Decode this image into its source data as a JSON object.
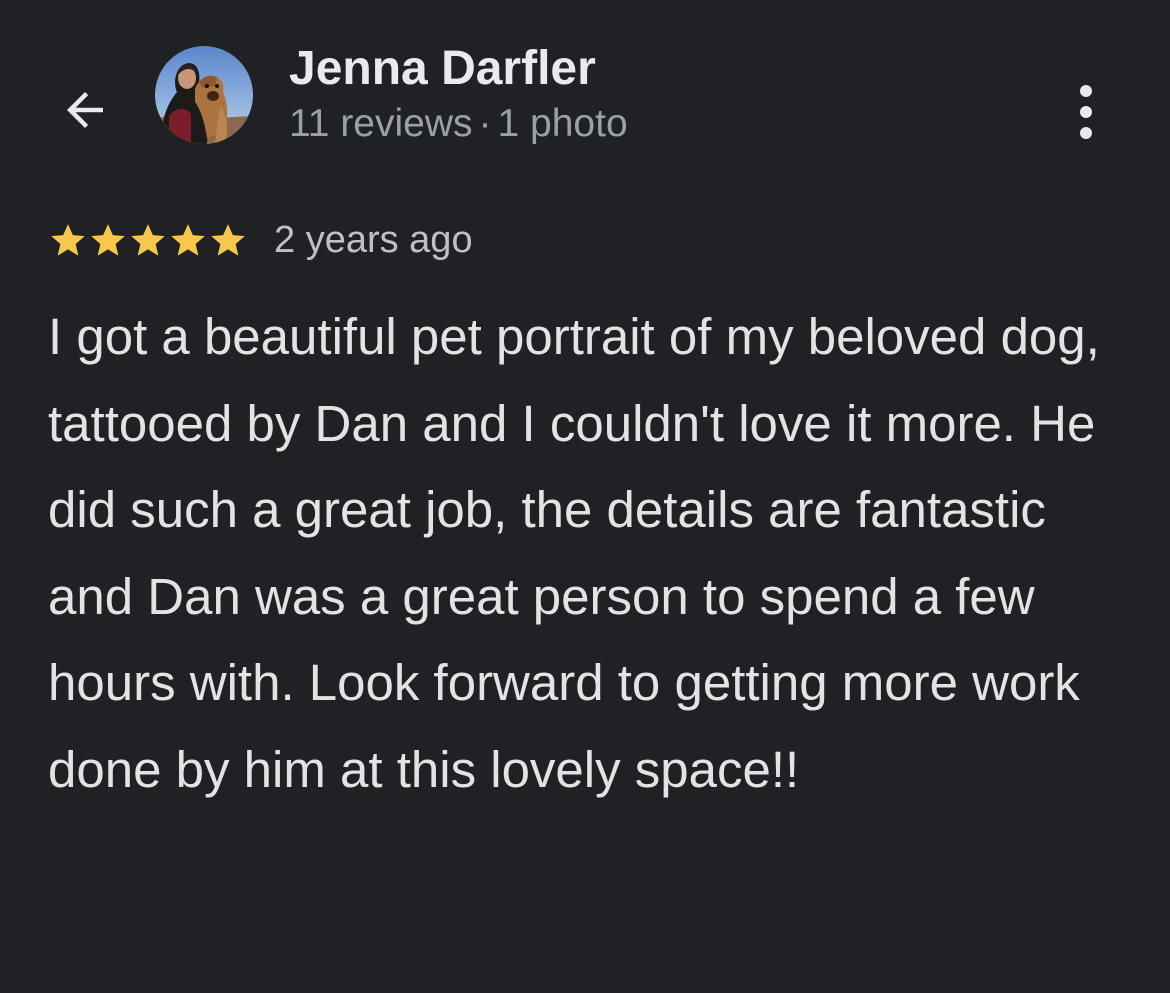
{
  "header": {
    "back_icon": "arrow-back-icon",
    "avatar_icon": "reviewer-avatar",
    "more_icon": "more-vert-icon"
  },
  "reviewer": {
    "name": "Jenna Darfler",
    "reviews_count": "11 reviews",
    "separator": "·",
    "photos_count": "1 photo"
  },
  "review": {
    "rating": 5,
    "max_rating": 5,
    "star_color": "#f8c84a",
    "date": "2 years ago",
    "text": "I got a beautiful pet portrait of my beloved dog, tattooed by Dan and I couldn't love it more. He did such a great job, the details are fantastic and Dan was a great person to spend a few hours with. Look forward to getting more work done by him at this lovely space!!"
  }
}
